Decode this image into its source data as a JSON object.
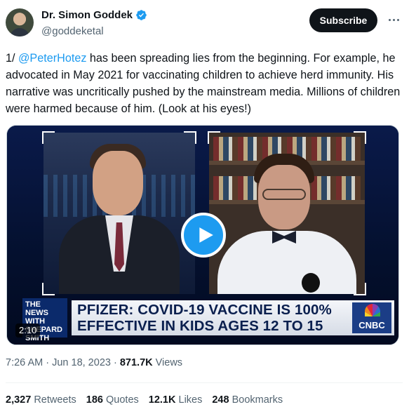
{
  "author": {
    "name": "Dr. Simon Goddek",
    "handle": "@goddeketal",
    "verified": true
  },
  "header": {
    "subscribe_label": "Subscribe",
    "more_icon": "more-horizontal-icon"
  },
  "tweet": {
    "prefix": "1/ ",
    "mention": "@PeterHotez",
    "body": " has been spreading lies from the beginning. For example, he advocated in May 2021 for vaccinating children to achieve herd immunity. His narrative was uncritically pushed by the mainstream media. Millions of children were harmed because of him. (Look at his eyes!)"
  },
  "media": {
    "headline_line1": "PFIZER: COVID-19 VACCINE IS 100%",
    "headline_line2": "EFFECTIVE IN KIDS AGES 12 TO 15",
    "show_logo": "THE NEWS WITH SHEPARD SMITH",
    "network": "CNBC",
    "duration": "2:10",
    "play_icon": "play-icon"
  },
  "meta": {
    "time": "7:26 AM",
    "date": "Jun 18, 2023",
    "views_count": "871.7K",
    "views_label": "Views"
  },
  "stats": {
    "retweets_count": "2,327",
    "retweets_label": "Retweets",
    "quotes_count": "186",
    "quotes_label": "Quotes",
    "likes_count": "12.1K",
    "likes_label": "Likes",
    "bookmarks_count": "248",
    "bookmarks_label": "Bookmarks"
  },
  "colors": {
    "accent": "#1d9bf0",
    "text": "#0f1419",
    "muted": "#536471",
    "button": "#0f1419"
  }
}
